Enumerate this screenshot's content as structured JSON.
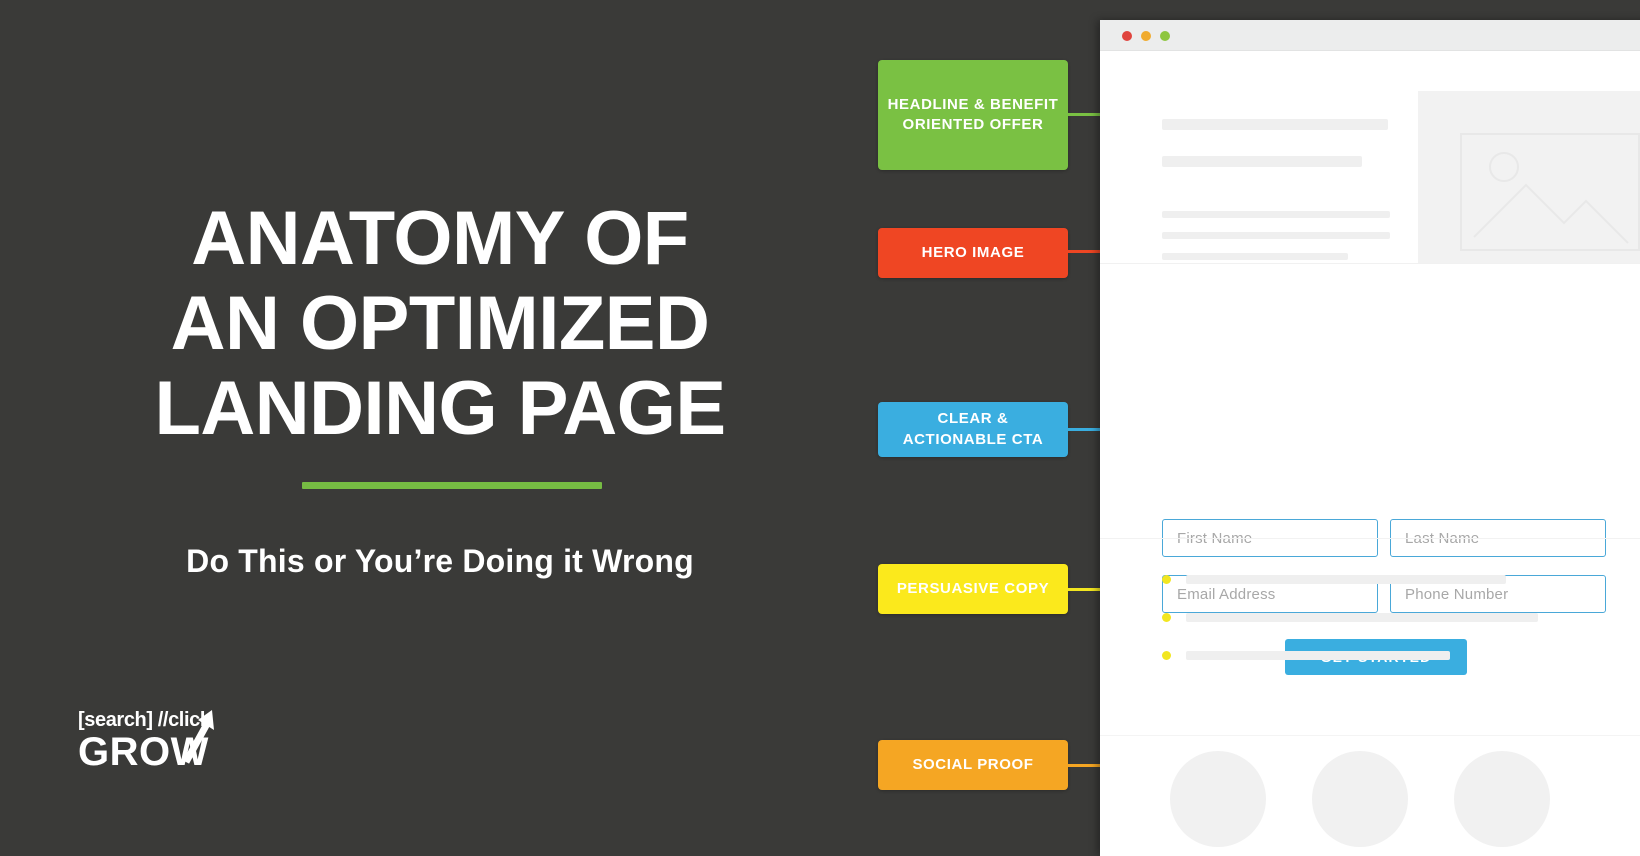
{
  "page": {
    "background_color": "#3a3a38",
    "title_lines": [
      "ANATOMY OF",
      "AN OPTIMIZED",
      "LANDING PAGE"
    ],
    "subtitle": "Do This or You’re Doing it Wrong",
    "divider_color": "#76bc43"
  },
  "logo": {
    "top_text": "[search] //click",
    "bottom_text": "GROW"
  },
  "callouts": [
    {
      "id": "headline-benefit",
      "lines": [
        "HEADLINE & BENEFIT",
        "ORIENTED OFFER"
      ],
      "color": "#7ac143"
    },
    {
      "id": "hero-image",
      "lines": [
        "HERO IMAGE"
      ],
      "color": "#ef4623"
    },
    {
      "id": "clear-actionable-cta",
      "lines": [
        "CLEAR &",
        "ACTIONABLE CTA"
      ],
      "color": "#3aaee0"
    },
    {
      "id": "persuasive-copy",
      "lines": [
        "PERSUASIVE COPY"
      ],
      "color": "#fbe91c"
    },
    {
      "id": "social-proof",
      "lines": [
        "SOCIAL PROOF"
      ],
      "color": "#f5a623"
    }
  ],
  "browser": {
    "traffic_lights": [
      {
        "name": "close",
        "color": "#e0443e"
      },
      {
        "name": "minimize",
        "color": "#f0ab2e"
      },
      {
        "name": "maximize",
        "color": "#8ec63f"
      }
    ],
    "hero": {
      "image_placeholder_icon": "image-placeholder-icon"
    },
    "form": {
      "fields": [
        {
          "name": "first-name",
          "placeholder": "First Name"
        },
        {
          "name": "last-name",
          "placeholder": "Last Name"
        },
        {
          "name": "email-address",
          "placeholder": "Email Address"
        },
        {
          "name": "phone-number",
          "placeholder": "Phone Number"
        }
      ],
      "cta_label": "GET STARTED",
      "cta_color": "#3aaee0",
      "field_border_color": "#4aa8d8"
    },
    "copy": {
      "bullet_color": "#f2e620",
      "bullet_count": 3
    },
    "social_proof": {
      "circle_count": 3,
      "circle_color": "#f1f1f1"
    }
  }
}
